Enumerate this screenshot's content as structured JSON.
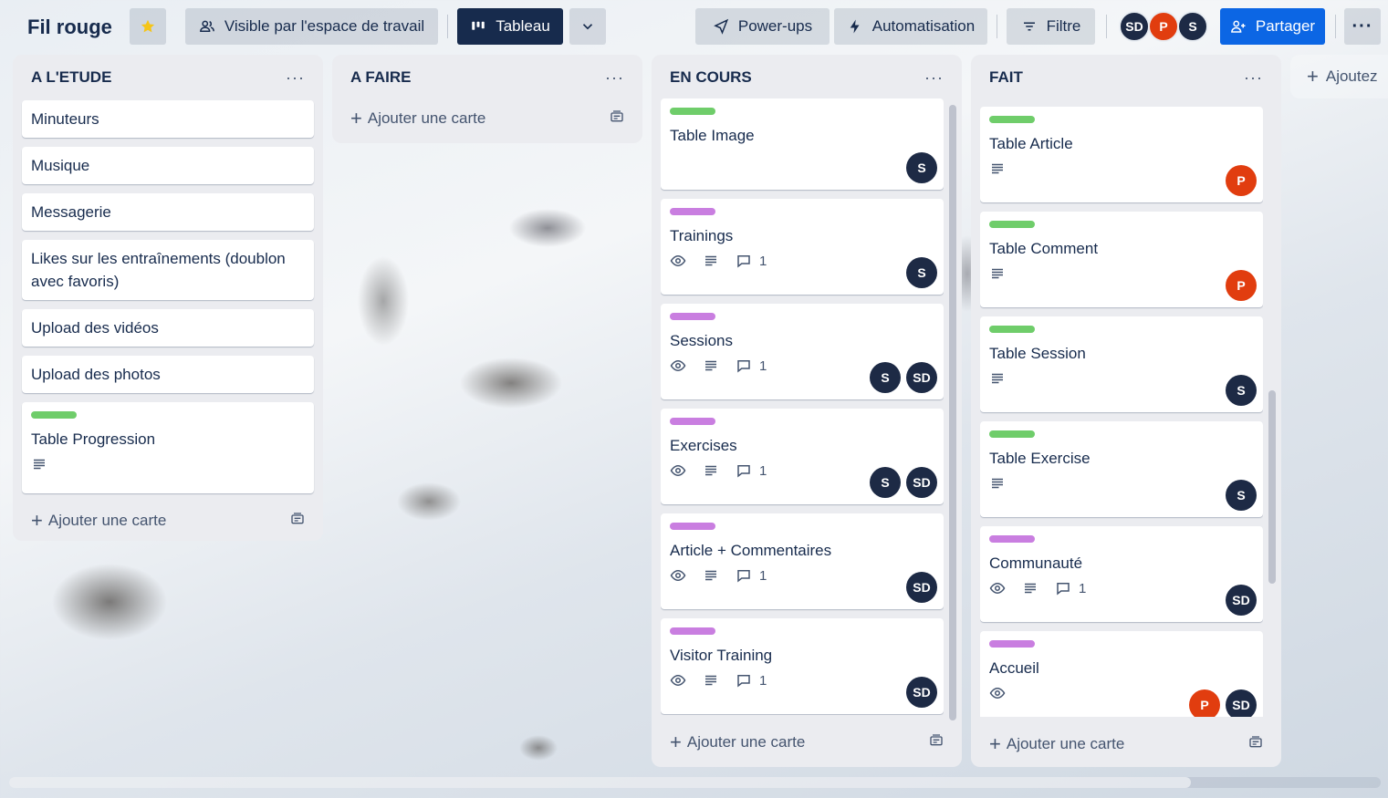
{
  "header": {
    "board_title": "Fil rouge",
    "visibility_label": "Visible par l'espace de travail",
    "view_label": "Tableau",
    "powerups_label": "Power-ups",
    "automation_label": "Automatisation",
    "filter_label": "Filtre",
    "share_label": "Partager",
    "members": [
      "SD",
      "P",
      "S"
    ]
  },
  "lists": [
    {
      "title": "A L'ETUDE",
      "add_card_label": "Ajouter une carte",
      "cards": [
        {
          "title": "Minuteurs"
        },
        {
          "title": "Musique"
        },
        {
          "title": "Messagerie"
        },
        {
          "title": "Likes sur les entraînements (doublon avec favoris)"
        },
        {
          "title": "Upload des vidéos"
        },
        {
          "title": "Upload des photos"
        },
        {
          "title": "Table Progression",
          "label": "green",
          "description": true
        }
      ]
    },
    {
      "title": "A FAIRE",
      "add_card_label": "Ajouter une carte",
      "cards": []
    },
    {
      "title": "EN COURS",
      "add_card_label": "Ajouter une carte",
      "cards": [
        {
          "title": "Table Image",
          "label": "green",
          "members": [
            "S"
          ]
        },
        {
          "title": "Trainings",
          "label": "purple",
          "watch": true,
          "description": true,
          "comments": "1",
          "members": [
            "S"
          ]
        },
        {
          "title": "Sessions",
          "label": "purple",
          "watch": true,
          "description": true,
          "comments": "1",
          "members": [
            "S",
            "SD"
          ]
        },
        {
          "title": "Exercises",
          "label": "purple",
          "watch": true,
          "description": true,
          "comments": "1",
          "members": [
            "S",
            "SD"
          ]
        },
        {
          "title": "Article + Commentaires",
          "label": "purple",
          "watch": true,
          "description": true,
          "comments": "1",
          "members": [
            "SD"
          ]
        },
        {
          "title": "Visitor Training",
          "label": "purple",
          "watch": true,
          "description": true,
          "comments": "1",
          "members": [
            "SD"
          ]
        }
      ]
    },
    {
      "title": "FAIT",
      "add_card_label": "Ajouter une carte",
      "cards": [
        {
          "title": "Table Article",
          "label": "green",
          "description": true,
          "members": [
            "P"
          ]
        },
        {
          "title": "Table Comment",
          "label": "green",
          "description": true,
          "members": [
            "P"
          ]
        },
        {
          "title": "Table Session",
          "label": "green",
          "description": true,
          "members": [
            "S"
          ]
        },
        {
          "title": "Table Exercise",
          "label": "green",
          "description": true,
          "members": [
            "S"
          ]
        },
        {
          "title": "Communauté",
          "label": "purple",
          "watch": true,
          "description": true,
          "comments": "1",
          "members": [
            "SD"
          ]
        },
        {
          "title": "Accueil",
          "label": "purple",
          "watch": true,
          "members": [
            "P",
            "SD"
          ]
        }
      ]
    }
  ],
  "add_list_label": "Ajoutez",
  "colors": {
    "label_green": "#6fcd6a",
    "label_purple": "#c97ee0",
    "avatar_dark": "#1d2a45",
    "avatar_red": "#e13d0f",
    "share_blue": "#0c66e4",
    "view_dark": "#172b4d"
  }
}
